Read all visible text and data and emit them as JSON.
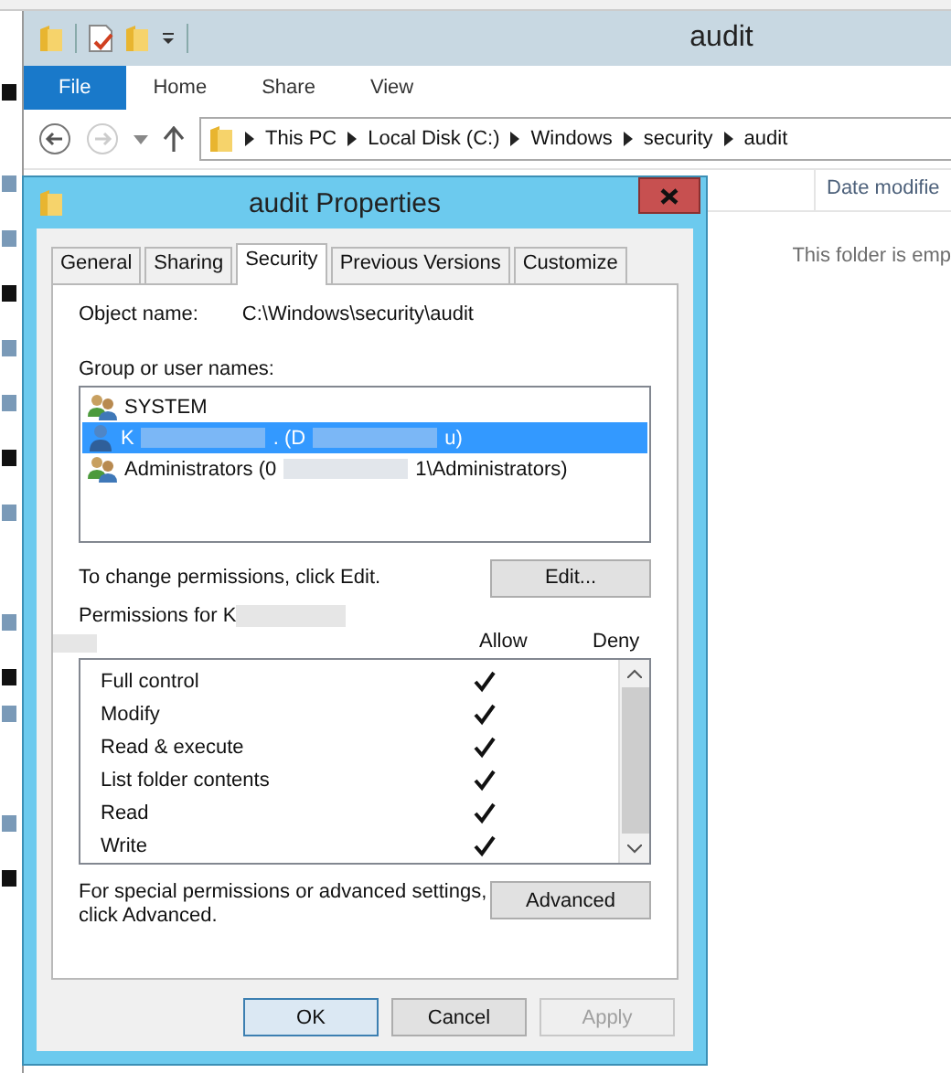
{
  "explorer": {
    "title": "audit",
    "ribbon_tabs": [
      {
        "label": "File",
        "selected": true
      },
      {
        "label": "Home",
        "selected": false
      },
      {
        "label": "Share",
        "selected": false
      },
      {
        "label": "View",
        "selected": false
      }
    ],
    "forward_disabled": true,
    "breadcrumb": [
      "This PC",
      "Local Disk (C:)",
      "Windows",
      "security",
      "audit"
    ],
    "columns": [
      "Date modifie"
    ],
    "empty_message": "This folder is emp"
  },
  "dialog": {
    "title": "audit Properties",
    "tabs": [
      {
        "label": "General",
        "selected": false
      },
      {
        "label": "Sharing",
        "selected": false
      },
      {
        "label": "Security",
        "selected": true
      },
      {
        "label": "Previous Versions",
        "selected": false
      },
      {
        "label": "Customize",
        "selected": false
      }
    ],
    "object_label": "Object name:",
    "object_value": "C:\\Windows\\security\\audit",
    "group_label": "Group or user names:",
    "principals": [
      {
        "kind": "group",
        "parts": [
          "SYSTEM"
        ],
        "selected": false
      },
      {
        "kind": "user",
        "parts": [
          "K",
          ". (D",
          "u)"
        ],
        "selected": true
      },
      {
        "kind": "group",
        "parts": [
          "Administrators (0",
          "1\\Administrators)"
        ],
        "selected": false
      }
    ],
    "change_hint": "To change permissions, click Edit.",
    "edit_button": "Edit...",
    "permissions_label": "Permissions for K",
    "allow_header": "Allow",
    "deny_header": "Deny",
    "permissions": [
      {
        "name": "Full control",
        "allow": true,
        "deny": false
      },
      {
        "name": "Modify",
        "allow": true,
        "deny": false
      },
      {
        "name": "Read & execute",
        "allow": true,
        "deny": false
      },
      {
        "name": "List folder contents",
        "allow": true,
        "deny": false
      },
      {
        "name": "Read",
        "allow": true,
        "deny": false
      },
      {
        "name": "Write",
        "allow": true,
        "deny": false
      }
    ],
    "special_hint": "For special permissions or advanced settings, click Advanced.",
    "advanced_button": "Advanced",
    "buttons": [
      {
        "label": "OK",
        "kind": "default",
        "disabled": false
      },
      {
        "label": "Cancel",
        "kind": "normal",
        "disabled": false
      },
      {
        "label": "Apply",
        "kind": "normal",
        "disabled": true
      }
    ]
  }
}
